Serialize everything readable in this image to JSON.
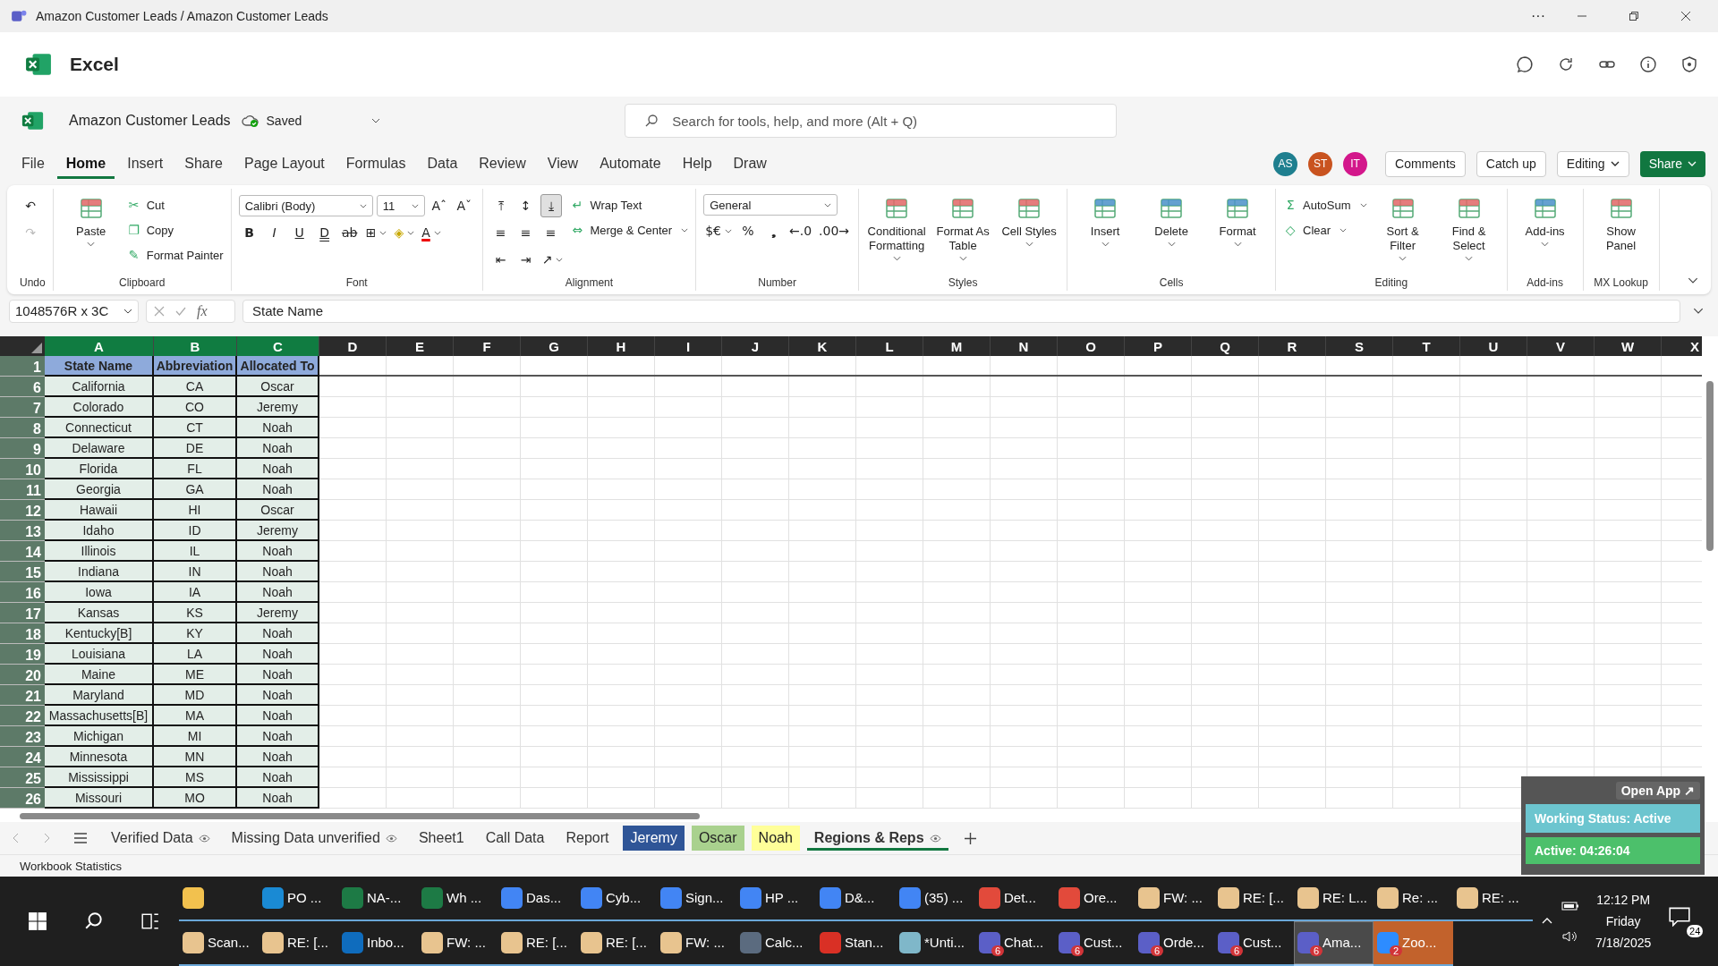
{
  "window": {
    "title": "Amazon Customer Leads / Amazon Customer Leads",
    "more": "···"
  },
  "app": {
    "name": "Excel"
  },
  "file": {
    "name": "Amazon Customer Leads",
    "status": "Saved"
  },
  "search": {
    "placeholder": "Search for tools, help, and more (Alt + Q)"
  },
  "menu_tabs": [
    {
      "label": "File",
      "selected": false
    },
    {
      "label": "Home",
      "selected": true
    },
    {
      "label": "Insert",
      "selected": false
    },
    {
      "label": "Share",
      "selected": false
    },
    {
      "label": "Page Layout",
      "selected": false
    },
    {
      "label": "Formulas",
      "selected": false
    },
    {
      "label": "Data",
      "selected": false
    },
    {
      "label": "Review",
      "selected": false
    },
    {
      "label": "View",
      "selected": false
    },
    {
      "label": "Automate",
      "selected": false
    },
    {
      "label": "Help",
      "selected": false
    },
    {
      "label": "Draw",
      "selected": false
    }
  ],
  "avatars": [
    {
      "initials": "AS",
      "color": "#1f7f8f"
    },
    {
      "initials": "ST",
      "color": "#c9531f"
    },
    {
      "initials": "IT",
      "color": "#d3178b"
    }
  ],
  "header_buttons": [
    {
      "label": "Comments",
      "kind": "outline"
    },
    {
      "label": "Catch up",
      "kind": "outline"
    },
    {
      "label": "Editing",
      "kind": "dropdown"
    },
    {
      "label": "Share",
      "kind": "primary"
    }
  ],
  "ribbon": [
    {
      "label": "Undo",
      "columns": [
        {
          "kind": "stack",
          "lines": [
            {
              "items": [
                {
                  "kind": "icon",
                  "glyph": "↶",
                  "disabled": false
                }
              ]
            },
            {
              "items": [
                {
                  "kind": "icon",
                  "glyph": "↷",
                  "disabled": true
                }
              ]
            }
          ]
        }
      ]
    },
    {
      "label": "Clipboard",
      "columns": [
        {
          "kind": "large",
          "label": "Paste",
          "caret": true
        },
        {
          "kind": "stack",
          "lines": [
            {
              "items": [
                {
                  "kind": "small",
                  "glyph": "✂",
                  "label": "Cut"
                }
              ]
            },
            {
              "items": [
                {
                  "kind": "small",
                  "glyph": "❐",
                  "label": "Copy"
                }
              ]
            },
            {
              "items": [
                {
                  "kind": "small",
                  "glyph": "✎",
                  "label": "Format Painter"
                }
              ]
            }
          ]
        }
      ]
    },
    {
      "label": "Font",
      "columns": [
        {
          "kind": "stack",
          "lines": [
            {
              "items": [
                {
                  "kind": "select",
                  "label": "Calibri (Body)"
                },
                {
                  "kind": "select",
                  "label": "11"
                },
                {
                  "kind": "icon",
                  "glyph": "Aˆ"
                },
                {
                  "kind": "icon",
                  "glyph": "Aˇ"
                }
              ]
            },
            {
              "items": [
                {
                  "kind": "bold",
                  "glyph": "B"
                },
                {
                  "kind": "italic",
                  "glyph": "I"
                },
                {
                  "kind": "underline",
                  "glyph": "U"
                },
                {
                  "kind": "double",
                  "glyph": "D"
                },
                {
                  "kind": "strike",
                  "glyph": "ab"
                },
                {
                  "kind": "icon",
                  "glyph": "⊞",
                  "caret": true
                },
                {
                  "kind": "fill",
                  "glyph": "◈",
                  "caret": true
                },
                {
                  "kind": "color",
                  "glyph": "A",
                  "caret": true
                }
              ]
            }
          ]
        }
      ]
    },
    {
      "label": "Alignment",
      "columns": [
        {
          "kind": "stack",
          "lines": [
            {
              "items": [
                {
                  "kind": "icon",
                  "glyph": "⤒"
                },
                {
                  "kind": "icon",
                  "glyph": "↕"
                },
                {
                  "kind": "icon",
                  "glyph": "⤓",
                  "selected": true
                }
              ]
            },
            {
              "items": [
                {
                  "kind": "icon",
                  "glyph": "≡"
                },
                {
                  "kind": "icon",
                  "glyph": "≡"
                },
                {
                  "kind": "icon",
                  "glyph": "≡"
                }
              ]
            },
            {
              "items": [
                {
                  "kind": "icon",
                  "glyph": "⇤"
                },
                {
                  "kind": "icon",
                  "glyph": "⇥"
                },
                {
                  "kind": "icon",
                  "glyph": "↗",
                  "caret": true
                }
              ]
            }
          ]
        },
        {
          "kind": "stack",
          "lines": [
            {
              "items": [
                {
                  "kind": "small",
                  "glyph": "↵",
                  "label": "Wrap Text"
                }
              ]
            },
            {
              "items": [
                {
                  "kind": "small",
                  "glyph": "⇔",
                  "label": "Merge & Center",
                  "caret": true
                }
              ]
            }
          ]
        }
      ]
    },
    {
      "label": "Number",
      "columns": [
        {
          "kind": "stack",
          "lines": [
            {
              "items": [
                {
                  "kind": "select",
                  "label": "General"
                }
              ]
            },
            {
              "items": [
                {
                  "kind": "icon",
                  "glyph": "$€",
                  "caret": true
                },
                {
                  "kind": "icon",
                  "glyph": "%"
                },
                {
                  "kind": "icon",
                  "glyph": "❟"
                },
                {
                  "kind": "icon",
                  "glyph": "←.0"
                },
                {
                  "kind": "icon",
                  "glyph": ".00→"
                }
              ]
            }
          ]
        }
      ]
    },
    {
      "label": "Styles",
      "columns": [
        {
          "kind": "large",
          "label": "Conditional Formatting",
          "caret": true
        },
        {
          "kind": "large",
          "label": "Format As Table",
          "caret": true
        },
        {
          "kind": "large",
          "label": "Cell Styles",
          "caret": true
        }
      ]
    },
    {
      "label": "Cells",
      "columns": [
        {
          "kind": "large",
          "label": "Insert",
          "caret": true
        },
        {
          "kind": "large",
          "label": "Delete",
          "caret": true
        },
        {
          "kind": "large",
          "label": "Format",
          "caret": true
        }
      ]
    },
    {
      "label": "Editing",
      "columns": [
        {
          "kind": "stack",
          "lines": [
            {
              "items": [
                {
                  "kind": "small",
                  "glyph": "Σ",
                  "label": "AutoSum",
                  "caret": true
                }
              ]
            },
            {
              "items": [
                {
                  "kind": "small",
                  "glyph": "◇",
                  "label": "Clear",
                  "caret": true
                }
              ]
            }
          ]
        },
        {
          "kind": "large",
          "label": "Sort & Filter",
          "caret": true
        },
        {
          "kind": "large",
          "label": "Find & Select",
          "caret": true
        }
      ]
    },
    {
      "label": "Add-ins",
      "columns": [
        {
          "kind": "large",
          "label": "Add-ins",
          "caret": true
        }
      ]
    },
    {
      "label": "MX Lookup",
      "columns": [
        {
          "kind": "large",
          "label": "Show Panel",
          "caret": false
        }
      ]
    }
  ],
  "formula_bar": {
    "name_box": "1048576R x 3C",
    "fx": "fx",
    "value": "State Name"
  },
  "sheet": {
    "columns": [
      {
        "label": "A",
        "selected": true
      },
      {
        "label": "B",
        "selected": true
      },
      {
        "label": "C",
        "selected": true
      },
      {
        "label": "D",
        "selected": false
      },
      {
        "label": "E",
        "selected": false
      },
      {
        "label": "F",
        "selected": false
      },
      {
        "label": "G",
        "selected": false
      },
      {
        "label": "H",
        "selected": false
      },
      {
        "label": "I",
        "selected": false
      },
      {
        "label": "J",
        "selected": false
      },
      {
        "label": "K",
        "selected": false
      },
      {
        "label": "L",
        "selected": false
      },
      {
        "label": "M",
        "selected": false
      },
      {
        "label": "N",
        "selected": false
      },
      {
        "label": "O",
        "selected": false
      },
      {
        "label": "P",
        "selected": false
      },
      {
        "label": "Q",
        "selected": false
      },
      {
        "label": "R",
        "selected": false
      },
      {
        "label": "S",
        "selected": false
      },
      {
        "label": "T",
        "selected": false
      },
      {
        "label": "U",
        "selected": false
      },
      {
        "label": "V",
        "selected": false
      },
      {
        "label": "W",
        "selected": false
      },
      {
        "label": "X",
        "selected": false
      }
    ],
    "rows": [
      {
        "label": "1",
        "kind": "header",
        "selected": true,
        "cells": [
          "State Name",
          "Abbreviation",
          "Allocated To"
        ]
      },
      {
        "label": "6",
        "kind": "data",
        "selected": true,
        "cells": [
          "California",
          "CA",
          "Oscar"
        ]
      },
      {
        "label": "7",
        "kind": "data",
        "selected": true,
        "cells": [
          "Colorado",
          "CO",
          "Jeremy"
        ]
      },
      {
        "label": "8",
        "kind": "data",
        "selected": true,
        "cells": [
          "Connecticut",
          "CT",
          "Noah"
        ]
      },
      {
        "label": "9",
        "kind": "data",
        "selected": true,
        "cells": [
          "Delaware",
          "DE",
          "Noah"
        ]
      },
      {
        "label": "10",
        "kind": "data",
        "selected": true,
        "cells": [
          "Florida",
          "FL",
          "Noah"
        ]
      },
      {
        "label": "11",
        "kind": "data",
        "selected": true,
        "cells": [
          "Georgia",
          "GA",
          "Noah"
        ]
      },
      {
        "label": "12",
        "kind": "data",
        "selected": true,
        "cells": [
          "Hawaii",
          "HI",
          "Oscar"
        ]
      },
      {
        "label": "13",
        "kind": "data",
        "selected": true,
        "cells": [
          "Idaho",
          "ID",
          "Jeremy"
        ]
      },
      {
        "label": "14",
        "kind": "data",
        "selected": true,
        "cells": [
          "Illinois",
          "IL",
          "Noah"
        ]
      },
      {
        "label": "15",
        "kind": "data",
        "selected": true,
        "cells": [
          "Indiana",
          "IN",
          "Noah"
        ]
      },
      {
        "label": "16",
        "kind": "data",
        "selected": true,
        "cells": [
          "Iowa",
          "IA",
          "Noah"
        ]
      },
      {
        "label": "17",
        "kind": "data",
        "selected": true,
        "cells": [
          "Kansas",
          "KS",
          "Jeremy"
        ]
      },
      {
        "label": "18",
        "kind": "data",
        "selected": true,
        "cells": [
          "Kentucky[B]",
          "KY",
          "Noah"
        ]
      },
      {
        "label": "19",
        "kind": "data",
        "selected": true,
        "cells": [
          "Louisiana",
          "LA",
          "Noah"
        ]
      },
      {
        "label": "20",
        "kind": "data",
        "selected": true,
        "cells": [
          "Maine",
          "ME",
          "Noah"
        ]
      },
      {
        "label": "21",
        "kind": "data",
        "selected": true,
        "cells": [
          "Maryland",
          "MD",
          "Noah"
        ]
      },
      {
        "label": "22",
        "kind": "data",
        "selected": true,
        "cells": [
          "Massachusetts[B]",
          "MA",
          "Noah"
        ]
      },
      {
        "label": "23",
        "kind": "data",
        "selected": true,
        "cells": [
          "Michigan",
          "MI",
          "Noah"
        ]
      },
      {
        "label": "24",
        "kind": "data",
        "selected": true,
        "cells": [
          "Minnesota",
          "MN",
          "Noah"
        ]
      },
      {
        "label": "25",
        "kind": "data",
        "selected": true,
        "cells": [
          "Mississippi",
          "MS",
          "Noah"
        ]
      },
      {
        "label": "26",
        "kind": "data",
        "selected": true,
        "cells": [
          "Missouri",
          "MO",
          "Noah"
        ]
      }
    ]
  },
  "sheet_tabs": [
    {
      "label": "Verified Data",
      "selected": false,
      "eye": true
    },
    {
      "label": "Missing Data unverified",
      "selected": false,
      "eye": true
    },
    {
      "label": "Sheet1",
      "selected": false,
      "eye": false
    },
    {
      "label": "Call Data",
      "selected": false,
      "eye": false
    },
    {
      "label": "Report",
      "selected": false,
      "eye": false
    },
    {
      "label": "Jeremy",
      "selected": false,
      "eye": false,
      "color": "#2f5597"
    },
    {
      "label": "Oscar",
      "selected": false,
      "eye": false,
      "color": "#a9d18e"
    },
    {
      "label": "Noah",
      "selected": false,
      "eye": false,
      "color": "#ffff99"
    },
    {
      "label": "Regions & Reps",
      "selected": true,
      "eye": true
    }
  ],
  "status_bar": {
    "text": "Workbook Statistics"
  },
  "overlay": {
    "open_app": "Open App ↗",
    "status": "Working Status: Active",
    "timer": "Active: 04:26:04"
  },
  "taskbar": {
    "rows": [
      [
        {
          "color": "#f2c14e",
          "selected": false,
          "flashing": false
        },
        {
          "label": "PO ...",
          "color": "#1a8ad4",
          "selected": false,
          "flashing": false
        },
        {
          "label": "NA-...",
          "color": "#1d7a45",
          "selected": false,
          "flashing": false
        },
        {
          "label": "Wh ...",
          "color": "#1d7a45",
          "selected": false,
          "flashing": false
        },
        {
          "label": "Das...",
          "color": "#4285f4",
          "selected": false,
          "flashing": false
        },
        {
          "label": "Cyb...",
          "color": "#4285f4",
          "selected": false,
          "flashing": false
        },
        {
          "label": "Sign...",
          "color": "#4285f4",
          "selected": false,
          "flashing": false
        },
        {
          "label": "HP ...",
          "color": "#4285f4",
          "selected": false,
          "flashing": false
        },
        {
          "label": "D&...",
          "color": "#4285f4",
          "selected": false,
          "flashing": false
        },
        {
          "label": "(35) ...",
          "color": "#4285f4",
          "selected": false,
          "flashing": false
        },
        {
          "label": "Det...",
          "color": "#e24a3b",
          "selected": false,
          "flashing": false
        },
        {
          "label": "Ore...",
          "color": "#e24a3b",
          "selected": false,
          "flashing": false
        },
        {
          "label": "FW: ...",
          "color": "#e8c48f",
          "selected": false,
          "flashing": false
        },
        {
          "label": "RE: [...",
          "color": "#e8c48f",
          "selected": false,
          "flashing": false
        },
        {
          "label": "RE: L...",
          "color": "#e8c48f",
          "selected": false,
          "flashing": false
        },
        {
          "label": "Re: ...",
          "color": "#e8c48f",
          "selected": false,
          "flashing": false
        },
        {
          "label": "RE: ...",
          "color": "#e8c48f",
          "selected": false,
          "flashing": false
        }
      ],
      [
        {
          "label": "Scan...",
          "color": "#e8c48f",
          "selected": false,
          "flashing": false
        },
        {
          "label": "RE: [...",
          "color": "#e8c48f",
          "selected": false,
          "flashing": false
        },
        {
          "label": "Inbo...",
          "color": "#0f6cbd",
          "selected": false,
          "flashing": false
        },
        {
          "label": "FW: ...",
          "color": "#e8c48f",
          "selected": false,
          "flashing": false
        },
        {
          "label": "RE: [...",
          "color": "#e8c48f",
          "selected": false,
          "flashing": false
        },
        {
          "label": "RE: [...",
          "color": "#e8c48f",
          "selected": false,
          "flashing": false
        },
        {
          "label": "FW: ...",
          "color": "#e8c48f",
          "selected": false,
          "flashing": false
        },
        {
          "label": "Calc...",
          "color": "#5b6b7f",
          "selected": false,
          "flashing": false
        },
        {
          "label": "Stan...",
          "color": "#d93025",
          "selected": false,
          "flashing": false
        },
        {
          "label": "*Unti...",
          "color": "#7fb7c9",
          "selected": false,
          "flashing": false
        },
        {
          "label": "Chat...",
          "color": "#5b5fc7",
          "badge": "6",
          "selected": false,
          "flashing": false
        },
        {
          "label": "Cust...",
          "color": "#5b5fc7",
          "badge": "6",
          "selected": false,
          "flashing": false
        },
        {
          "label": "Orde...",
          "color": "#5b5fc7",
          "badge": "6",
          "selected": false,
          "flashing": false
        },
        {
          "label": "Cust...",
          "color": "#5b5fc7",
          "badge": "6",
          "selected": false,
          "flashing": false
        },
        {
          "label": "Ama...",
          "color": "#5b5fc7",
          "badge": "6",
          "selected": true,
          "flashing": false
        },
        {
          "label": "Zoo...",
          "color": "#2d8cff",
          "badge": "2",
          "selected": false,
          "flashing": true
        }
      ]
    ],
    "time": "12:12 PM",
    "day": "Friday",
    "date": "7/18/2025",
    "notifications": "24"
  }
}
